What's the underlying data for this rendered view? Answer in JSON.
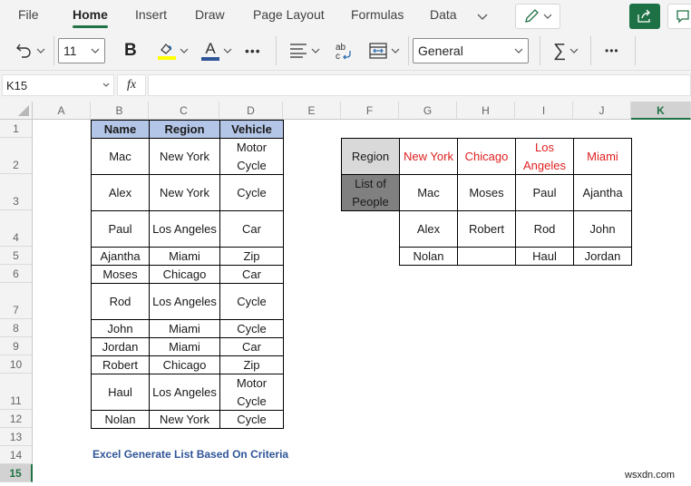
{
  "menu": {
    "tabs": [
      "File",
      "Home",
      "Insert",
      "Draw",
      "Page Layout",
      "Formulas",
      "Data"
    ],
    "active_tab": "Home"
  },
  "toolbar": {
    "font_size": "11",
    "bold_label": "B",
    "font_color_label": "A",
    "more_label": "•••",
    "number_format": "General",
    "sum_label": "∑",
    "highlight_color": "#ffff00",
    "font_color": "#2f5597"
  },
  "formula_bar": {
    "name_box": "K15",
    "fx_label": "fx",
    "formula": ""
  },
  "columns": [
    "A",
    "B",
    "C",
    "D",
    "E",
    "F",
    "G",
    "H",
    "I",
    "J",
    "K"
  ],
  "selected_column": "K",
  "rows": [
    "1",
    "2",
    "3",
    "4",
    "5",
    "6",
    "7",
    "8",
    "9",
    "10",
    "11",
    "12",
    "13",
    "14",
    "15"
  ],
  "selected_row": "15",
  "source_table": {
    "headers": [
      "Name",
      "Region",
      "Vehicle"
    ],
    "rows": [
      [
        "Mac",
        "New York",
        "Motor Cycle"
      ],
      [
        "Alex",
        "New York",
        "Cycle"
      ],
      [
        "Paul",
        "Los Angeles",
        "Car"
      ],
      [
        "Ajantha",
        "Miami",
        "Zip"
      ],
      [
        "Moses",
        "Chicago",
        "Car"
      ],
      [
        "Rod",
        "Los Angeles",
        "Cycle"
      ],
      [
        "John",
        "Miami",
        "Cycle"
      ],
      [
        "Jordan",
        "Miami",
        "Car"
      ],
      [
        "Robert",
        "Chicago",
        "Zip"
      ],
      [
        "Haul",
        "Los Angeles",
        "Motor Cycle"
      ],
      [
        "Nolan",
        "New York",
        "Cycle"
      ]
    ]
  },
  "result_table": {
    "region_label": "Region",
    "list_label": "List of People",
    "regions": [
      "New York",
      "Chicago",
      "Los Angeles",
      "Miami"
    ],
    "people": [
      [
        "Mac",
        "Moses",
        "Paul",
        "Ajantha"
      ],
      [
        "Alex",
        "Robert",
        "Rod",
        "John"
      ],
      [
        "Nolan",
        "",
        "Haul",
        "Jordan"
      ]
    ]
  },
  "caption": "Excel Generate List Based On Criteria",
  "watermark": "wsxdn.com"
}
